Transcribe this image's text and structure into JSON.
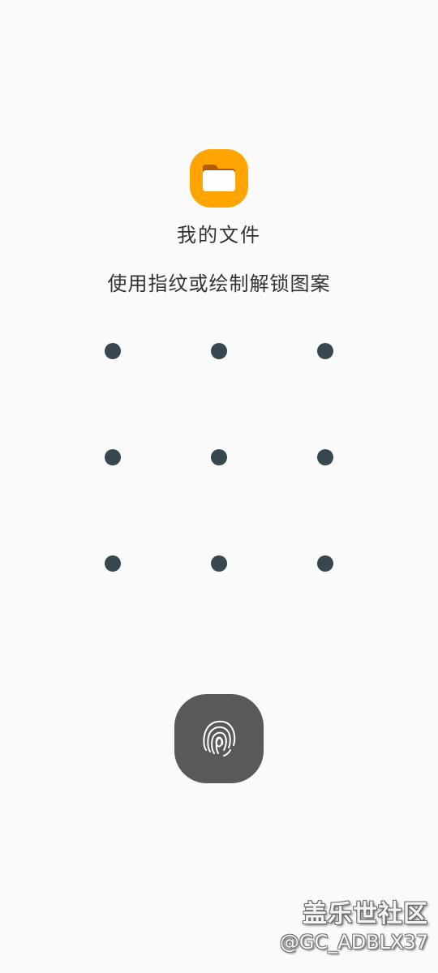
{
  "app": {
    "icon": "folder-icon",
    "icon_color": "#ffa400",
    "title": "我的文件"
  },
  "lock": {
    "instruction": "使用指纹或绘制解锁图案",
    "dot_color": "#37474f",
    "grid_rows": 3,
    "grid_cols": 3,
    "fingerprint_icon": "fingerprint-icon",
    "fingerprint_button_color": "#595959"
  },
  "watermark": {
    "title": "盖乐世社区",
    "handle": "@GC_ADBLX37"
  }
}
